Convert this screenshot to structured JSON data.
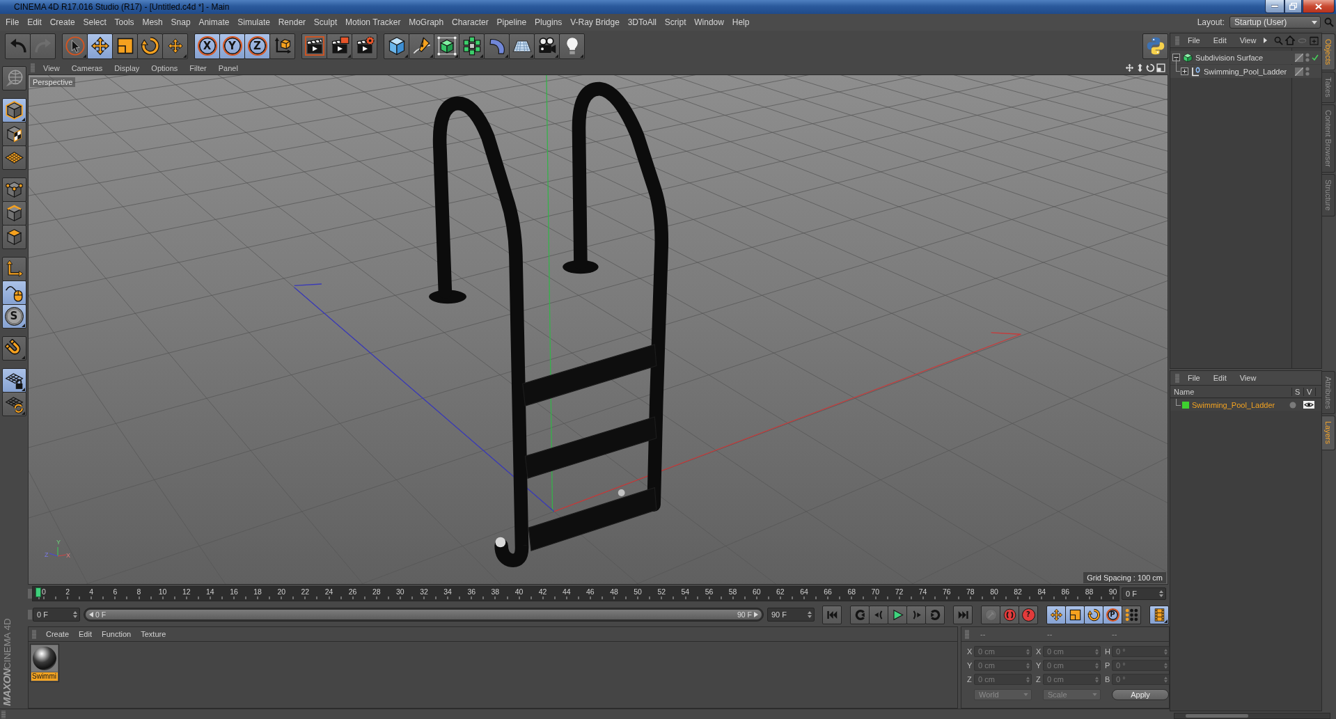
{
  "window": {
    "title": "CINEMA 4D R17.016 Studio (R17) - [Untitled.c4d *] - Main"
  },
  "menu_bar": {
    "items": [
      "File",
      "Edit",
      "Create",
      "Select",
      "Tools",
      "Mesh",
      "Snap",
      "Animate",
      "Simulate",
      "Render",
      "Sculpt",
      "Motion Tracker",
      "MoGraph",
      "Character",
      "Pipeline",
      "Plugins",
      "V-Ray Bridge",
      "3DToAll",
      "Script",
      "Window",
      "Help"
    ],
    "layout_label": "Layout:",
    "layout_value": "Startup (User)"
  },
  "toolbar": {
    "groups": [
      [
        {
          "kind": "undo",
          "selected": false,
          "disabled": false,
          "menu": false
        },
        {
          "kind": "redo",
          "selected": false,
          "disabled": true,
          "menu": false
        }
      ],
      [
        {
          "kind": "select",
          "selected": false,
          "disabled": false,
          "menu": true
        },
        {
          "kind": "move",
          "selected": true,
          "disabled": false,
          "menu": false
        },
        {
          "kind": "scale",
          "selected": false,
          "disabled": false,
          "menu": false
        },
        {
          "kind": "rotate",
          "selected": false,
          "disabled": false,
          "menu": false
        },
        {
          "kind": "recent",
          "selected": false,
          "disabled": false,
          "menu": true
        }
      ],
      [
        {
          "kind": "axis",
          "label": "X",
          "selected": true,
          "disabled": false,
          "menu": false
        },
        {
          "kind": "axis",
          "label": "Y",
          "selected": true,
          "disabled": false,
          "menu": false
        },
        {
          "kind": "axis",
          "label": "Z",
          "selected": true,
          "disabled": false,
          "menu": false
        },
        {
          "kind": "coords",
          "selected": false,
          "disabled": false,
          "menu": false
        }
      ],
      [
        {
          "kind": "renderview",
          "selected": false,
          "disabled": false,
          "menu": false
        },
        {
          "kind": "renderpicture",
          "selected": false,
          "disabled": false,
          "menu": true
        },
        {
          "kind": "rendersettings",
          "selected": false,
          "disabled": false,
          "menu": false
        }
      ],
      [
        {
          "kind": "cube",
          "selected": false,
          "disabled": false,
          "menu": true
        },
        {
          "kind": "pen",
          "selected": false,
          "disabled": false,
          "menu": true
        },
        {
          "kind": "subdivision",
          "selected": false,
          "disabled": false,
          "menu": true
        },
        {
          "kind": "cloner",
          "selected": false,
          "disabled": false,
          "menu": true
        },
        {
          "kind": "deformer",
          "selected": false,
          "disabled": false,
          "menu": true
        },
        {
          "kind": "floor",
          "selected": false,
          "disabled": false,
          "menu": true
        },
        {
          "kind": "camera",
          "selected": false,
          "disabled": false,
          "menu": true
        },
        {
          "kind": "light",
          "selected": false,
          "disabled": false,
          "menu": true
        }
      ]
    ],
    "end_groups": [
      [
        {
          "kind": "python",
          "selected": false,
          "disabled": false,
          "menu": false
        }
      ]
    ]
  },
  "tool_strip": {
    "groups": [
      [
        {
          "kind": "makeeditable",
          "selected": false,
          "disabled": false,
          "menu": false
        }
      ],
      [
        {
          "kind": "model",
          "selected": true,
          "disabled": false,
          "menu": true
        },
        {
          "kind": "texture",
          "selected": false,
          "disabled": false,
          "menu": false
        },
        {
          "kind": "workplane",
          "selected": false,
          "disabled": false,
          "menu": false
        }
      ],
      [
        {
          "kind": "points",
          "selected": false,
          "disabled": false,
          "menu": false
        },
        {
          "kind": "edges",
          "selected": false,
          "disabled": false,
          "menu": false
        },
        {
          "kind": "polygons",
          "selected": false,
          "disabled": false,
          "menu": false
        }
      ],
      [
        {
          "kind": "axismode",
          "selected": false,
          "disabled": false,
          "menu": false
        },
        {
          "kind": "tweak",
          "selected": true,
          "disabled": false,
          "menu": false
        },
        {
          "kind": "snap",
          "label": "S",
          "selected": true,
          "disabled": false,
          "menu": true
        }
      ],
      [
        {
          "kind": "magnet",
          "selected": false,
          "disabled": false,
          "menu": true
        }
      ],
      [
        {
          "kind": "gridlock",
          "selected": true,
          "disabled": false,
          "menu": true
        },
        {
          "kind": "gridrotate",
          "selected": false,
          "disabled": false,
          "menu": true
        }
      ]
    ]
  },
  "viewport": {
    "menu": [
      "View",
      "Cameras",
      "Display",
      "Options",
      "Filter",
      "Panel"
    ],
    "camera": "Perspective",
    "grid_spacing": "Grid Spacing : 100 cm",
    "gizmo_labels": [
      "Y",
      "Z",
      "X"
    ]
  },
  "timeline": {
    "ticks": [
      "0",
      "2",
      "4",
      "6",
      "8",
      "10",
      "12",
      "14",
      "16",
      "18",
      "20",
      "22",
      "24",
      "26",
      "28",
      "30",
      "32",
      "34",
      "36",
      "38",
      "40",
      "42",
      "44",
      "46",
      "48",
      "50",
      "52",
      "54",
      "56",
      "58",
      "60",
      "62",
      "64",
      "66",
      "68",
      "70",
      "72",
      "74",
      "76",
      "78",
      "80",
      "82",
      "84",
      "86",
      "88",
      "90"
    ],
    "level": 0,
    "frame_field": "0 F"
  },
  "transport": {
    "start_field": "0 F",
    "range_start": "0 F",
    "range_end": "90 F",
    "level": 1,
    "end_field": "90 F",
    "groups": [
      [
        {
          "kind": "firstframe",
          "selected": false,
          "disabled": false,
          "menu": false
        }
      ],
      [
        {
          "kind": "prevkey",
          "selected": false,
          "disabled": false,
          "menu": false
        },
        {
          "kind": "prevframe",
          "selected": false,
          "disabled": false,
          "menu": false
        },
        {
          "kind": "play",
          "selected": false,
          "disabled": false,
          "menu": false
        },
        {
          "kind": "nextframe",
          "selected": false,
          "disabled": false,
          "menu": false
        },
        {
          "kind": "nextkey",
          "selected": false,
          "disabled": false,
          "menu": false
        }
      ],
      [
        {
          "kind": "lastframe",
          "selected": false,
          "disabled": false,
          "menu": false
        }
      ],
      [
        {
          "kind": "keyframe",
          "selected": false,
          "disabled": true,
          "menu": false
        },
        {
          "kind": "record",
          "selected": false,
          "disabled": false,
          "menu": false
        },
        {
          "kind": "keyhelp",
          "label": "?",
          "selected": false,
          "disabled": false,
          "menu": false
        }
      ],
      [
        {
          "kind": "movekey",
          "selected": true,
          "disabled": false,
          "menu": false
        },
        {
          "kind": "scalekey",
          "selected": true,
          "disabled": false,
          "menu": false
        },
        {
          "kind": "rotatekey",
          "selected": true,
          "disabled": false,
          "menu": false
        },
        {
          "kind": "param",
          "label": "P",
          "selected": true,
          "disabled": false,
          "menu": false
        },
        {
          "kind": "pla",
          "selected": false,
          "disabled": false,
          "menu": false
        }
      ],
      [
        {
          "kind": "film",
          "selected": true,
          "disabled": false,
          "menu": true
        }
      ]
    ]
  },
  "material_manager": {
    "menu": [
      "Create",
      "Edit",
      "Function",
      "Texture"
    ],
    "materials": [
      {
        "name": "Swimmi",
        "selected": true
      }
    ]
  },
  "coordinates": {
    "headers": [
      "--",
      "--",
      "--"
    ],
    "rows": [
      {
        "axis": "X",
        "position": "0 cm",
        "size_axis": "X",
        "size": "0 cm",
        "angle_axis": "H",
        "angle": "0 °"
      },
      {
        "axis": "Y",
        "position": "0 cm",
        "size_axis": "Y",
        "size": "0 cm",
        "angle_axis": "P",
        "angle": "0 °"
      },
      {
        "axis": "Z",
        "position": "0 cm",
        "size_axis": "Z",
        "size": "0 cm",
        "angle_axis": "B",
        "angle": "0 °"
      }
    ],
    "dropdowns": [
      "World",
      "Scale"
    ],
    "apply": "Apply"
  },
  "brand": {
    "maker": "MAXON",
    "product": "CINEMA 4D"
  },
  "objects_panel": {
    "menu": [
      "File",
      "Edit",
      "View"
    ],
    "tree": [
      {
        "name": "Subdivision Surface",
        "kind": "subdivision",
        "expanded": true,
        "checked": true,
        "children": [
          {
            "name": "Swimming_Pool_Ladder",
            "kind": "null",
            "expanded": false,
            "checked": false
          }
        ]
      }
    ]
  },
  "layers_panel": {
    "menu": [
      "File",
      "Edit",
      "View"
    ],
    "columns": [
      "Name",
      "S",
      "V"
    ],
    "layers": [
      {
        "name": "Swimming_Pool_Ladder",
        "color": "#3ed12f",
        "selected": true
      }
    ]
  },
  "side_tabs": {
    "upper": [
      {
        "label": "Objects",
        "selected": true
      },
      {
        "label": "Takes",
        "selected": false
      },
      {
        "label": "Content Browser",
        "selected": false
      },
      {
        "label": "Structure",
        "selected": false
      }
    ],
    "lower": [
      {
        "label": "Attributes",
        "selected": false
      },
      {
        "label": "Layers",
        "selected": true
      }
    ]
  }
}
